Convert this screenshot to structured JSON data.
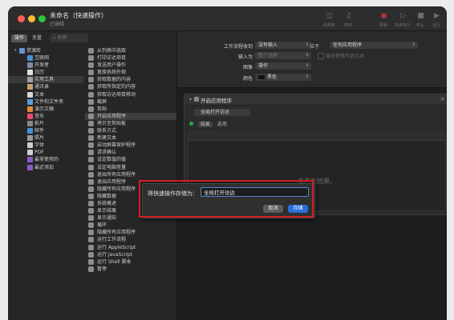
{
  "window": {
    "title": "未命名（快速操作）",
    "subtitle": "已编辑"
  },
  "toolbar": {
    "items": [
      {
        "icon": "library-icon",
        "label": "资源库"
      },
      {
        "icon": "media-icon",
        "label": "媒体"
      },
      {
        "icon": "record-icon",
        "label": "录制"
      },
      {
        "icon": "step-icon",
        "label": "单步执行"
      },
      {
        "icon": "stop-icon",
        "label": "停止"
      },
      {
        "icon": "run-icon",
        "label": "运行"
      }
    ]
  },
  "library_tabs": [
    "操作",
    "变量"
  ],
  "library_search": {
    "placeholder": "名称"
  },
  "library": [
    {
      "label": "资源库",
      "color": "#6a8fd1",
      "disclosure": "▾"
    },
    {
      "label": "互联网",
      "color": "#4a90d9"
    },
    {
      "label": "开发者",
      "color": "#7f8c9a"
    },
    {
      "label": "日历",
      "color": "#e0e0e0"
    },
    {
      "label": "实用工具",
      "color": "#a0a0a0"
    },
    {
      "label": "通讯录",
      "color": "#c9a270"
    },
    {
      "label": "文本",
      "color": "#d8d8d8"
    },
    {
      "label": "文件和文件夹",
      "color": "#5aa0e0"
    },
    {
      "label": "演示文稿",
      "color": "#e08a3c"
    },
    {
      "label": "音乐",
      "color": "#e84a6a"
    },
    {
      "label": "影片",
      "color": "#8a8a8a"
    },
    {
      "label": "邮件",
      "color": "#4a90d9"
    },
    {
      "label": "照片",
      "color": "#9a9a9a"
    },
    {
      "label": "字体",
      "color": "#d0d0d0"
    },
    {
      "label": "PDF",
      "color": "#d0d0d0"
    },
    {
      "label": "最常使用的",
      "color": "#8a5cc7"
    },
    {
      "label": "最近添加",
      "color": "#8a5cc7"
    }
  ],
  "actions": [
    "从列表中选取",
    "打印访达项目",
    "发送用户操作",
    "复原系统外观",
    "获取数据的内容",
    "获取所指定的内容",
    "获取访达项目移动",
    "截屏",
    "剪贴",
    "开启应用程序",
    "拷贝至剪贴板",
    "联系方式",
    "新建文本",
    "启动屏幕保护程序",
    "请求确认",
    "设定数值的值",
    "设定电脑音量",
    "退出所有应用程序",
    "退出应用程序",
    "隐藏所有应用程序",
    "隐藏数据",
    "系统概述",
    "显示结果",
    "显示通知",
    "循环",
    "隐藏所有应用程序",
    "运行工作流程",
    "运行 AppleScript",
    "运行 JavaScript",
    "运行 Shell 脚本",
    "暂停"
  ],
  "selected_action_index": 9,
  "settings": {
    "workflow_receives_label": "工作流程收到",
    "workflow_receives_value": "没有输入",
    "in_label": "位于",
    "in_value": "任何应用程序",
    "input_is_label": "输入为",
    "input_is_value": "整个选择",
    "output_replaces": "输出替换所选文本",
    "image_label": "图像",
    "image_value": "操作",
    "color_label": "颜色",
    "color_value": "黑色"
  },
  "action_card": {
    "title": "开启应用程序",
    "select_value": "全局打开访达",
    "tabs": [
      "结果",
      "选项"
    ],
    "empty_text": "未产生结果。"
  },
  "dialog": {
    "prompt": "将快速操作存储为：",
    "value": "全局打开访达",
    "cancel": "取消",
    "save": "存储"
  },
  "colors": {
    "accent": "#2a6fd8",
    "highlight_border": "#d21f25",
    "window_bg": "#232323"
  }
}
